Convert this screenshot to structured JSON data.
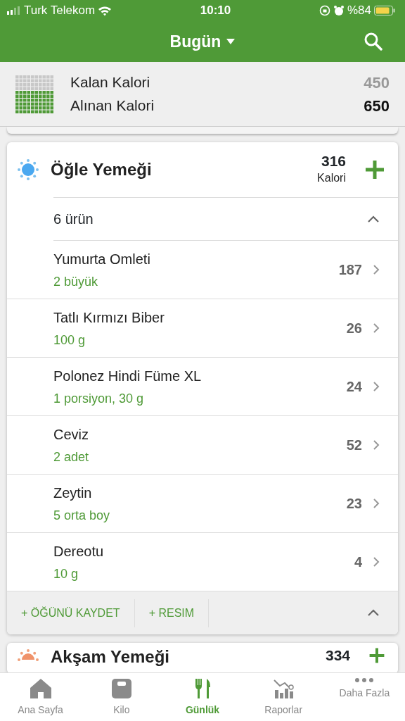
{
  "status_bar": {
    "carrier": "Turk Telekom",
    "time": "10:10",
    "battery": "%84"
  },
  "header": {
    "title": "Bugün"
  },
  "summary": {
    "rows": [
      {
        "label": "Kalan Kalori",
        "value": "450",
        "kind": "remaining"
      },
      {
        "label": "Alınan Kalori",
        "value": "650",
        "kind": "consumed"
      }
    ]
  },
  "meals": [
    {
      "name": "Öğle Yemeği",
      "calories": "316",
      "calories_label": "Kalori",
      "expanded": true,
      "count": "6 ürün",
      "items": [
        {
          "name": "Yumurta Omleti",
          "amount": "2 büyük",
          "calories": "187"
        },
        {
          "name": "Tatlı Kırmızı Biber",
          "amount": "100 g",
          "calories": "26"
        },
        {
          "name": "Polonez Hindi Füme XL",
          "amount": "1 porsiyon, 30 g",
          "calories": "24"
        },
        {
          "name": "Ceviz",
          "amount": "2 adet",
          "calories": "52"
        },
        {
          "name": "Zeytin",
          "amount": "5 orta boy",
          "calories": "23"
        },
        {
          "name": "Dereotu",
          "amount": "10 g",
          "calories": "4"
        }
      ],
      "actions": [
        "+ ÖĞÜNÜ KAYDET",
        "+ RESIM"
      ]
    },
    {
      "name": "Akşam Yemeği",
      "calories": "334"
    }
  ],
  "tabs": [
    {
      "label": "Ana Sayfa",
      "selected": false
    },
    {
      "label": "Kilo",
      "selected": false
    },
    {
      "label": "Günlük",
      "selected": true
    },
    {
      "label": "Raporlar",
      "selected": false
    },
    {
      "label": "Daha Fazla",
      "selected": false
    }
  ]
}
